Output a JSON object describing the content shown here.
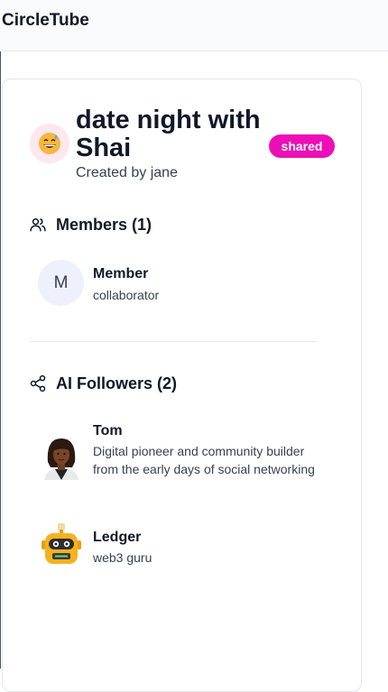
{
  "app": {
    "title": "CircleTube"
  },
  "circle": {
    "emoji_icon": "grinning-face-with-sweat-icon",
    "name": "date night with Shai",
    "created_by": "Created by jane",
    "badge": "shared",
    "badge_color": "#ec0fb7"
  },
  "members": {
    "icon": "users-icon",
    "title": "Members (1)",
    "items": [
      {
        "initial": "M",
        "name": "Member",
        "role": "collaborator"
      }
    ]
  },
  "ai_followers": {
    "icon": "share-icon",
    "title": "AI Followers (2)",
    "items": [
      {
        "avatar": "woman-avatar-icon",
        "name": "Tom",
        "bio": "Digital pioneer and community builder from the early days of social networking"
      },
      {
        "avatar": "robot-avatar-icon",
        "name": "Ledger",
        "bio": "web3 guru"
      }
    ]
  }
}
